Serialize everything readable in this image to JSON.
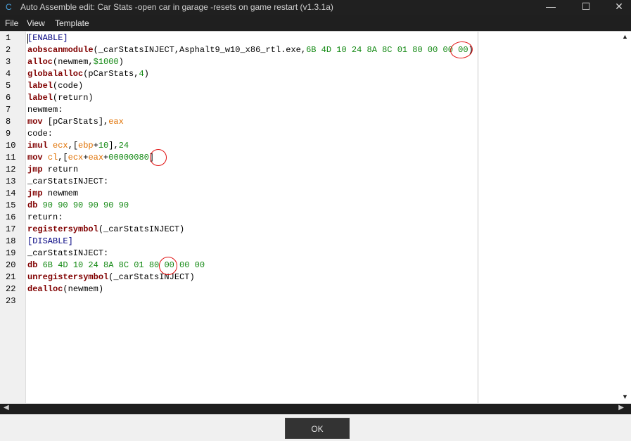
{
  "window": {
    "title": "Auto Assemble edit: Car Stats -open car in garage -resets on game restart (v1.3.1a)",
    "minimize_glyph": "—",
    "maximize_glyph": "☐",
    "close_glyph": "✕",
    "app_icon": "cheat-engine-icon"
  },
  "menu": {
    "file": "File",
    "view": "View",
    "template": "Template"
  },
  "line_numbers": [
    "1",
    "2",
    "3",
    "4",
    "5",
    "6",
    "7",
    "8",
    "9",
    "10",
    "11",
    "12",
    "13",
    "14",
    "15",
    "16",
    "17",
    "18",
    "19",
    "20",
    "21",
    "22",
    "23"
  ],
  "code": {
    "l1": "[ENABLE]",
    "l2_kw": "aobscanmodule",
    "l2_text": "(_carStatsINJECT,Asphalt9_w10_x86_rtl.exe,",
    "l2_bytes": "6B 4D 10 24 8A 8C 01 80 00 00 00",
    "l2_close": ")",
    "l3_kw": "alloc",
    "l3_text": "(newmem,",
    "l3_num": "$1000",
    "l3_close": ")",
    "l4_kw": "globalalloc",
    "l4_text": "(pCarStats,",
    "l4_num": "4",
    "l4_close": ")",
    "l5_kw": "label",
    "l5_text": "(code)",
    "l6_kw": "label",
    "l6_text": "(return)",
    "l7": "newmem:",
    "l8_kw": "mov",
    "l8_text": " [pCarStats],",
    "l8_reg": "eax",
    "l9": "code:",
    "l10_kw": "imul",
    "l10_reg1": "ecx",
    "l10_text1": ",[",
    "l10_reg2": "ebp",
    "l10_text2": "+",
    "l10_num1": "10",
    "l10_text3": "],",
    "l10_num2": "24",
    "l11_kw": "mov",
    "l11_reg1": "cl",
    "l11_text1": ",[",
    "l11_reg2": "ecx",
    "l11_text2": "+",
    "l11_reg3": "eax",
    "l11_text3": "+",
    "l11_num": "00000080",
    "l11_close": "]",
    "l12_kw": "jmp",
    "l12_text": " return",
    "l13": "_carStatsINJECT:",
    "l14_kw": "jmp",
    "l14_text": " newmem",
    "l15_kw": "db",
    "l15_num": "90 90 90 90 90 90",
    "l16": "return:",
    "l17_kw": "registersymbol",
    "l17_text": "(_carStatsINJECT)",
    "l18": "[DISABLE]",
    "l19": "_carStatsINJECT:",
    "l20_kw": "db",
    "l20_num": "6B 4D 10 24 8A 8C 01 80 00 00 00",
    "l21_kw": "unregistersymbol",
    "l21_text": "(_carStatsINJECT)",
    "l22_kw": "dealloc",
    "l22_text": "(newmem)"
  },
  "scroll": {
    "up": "▲",
    "down": "▼",
    "left": "◀",
    "right": "▶"
  },
  "ok_label": "OK",
  "colors": {
    "keyword": "#800000",
    "number": "#118811",
    "register": "#e07000",
    "directive": "#000080",
    "annotation": "#e01010"
  }
}
